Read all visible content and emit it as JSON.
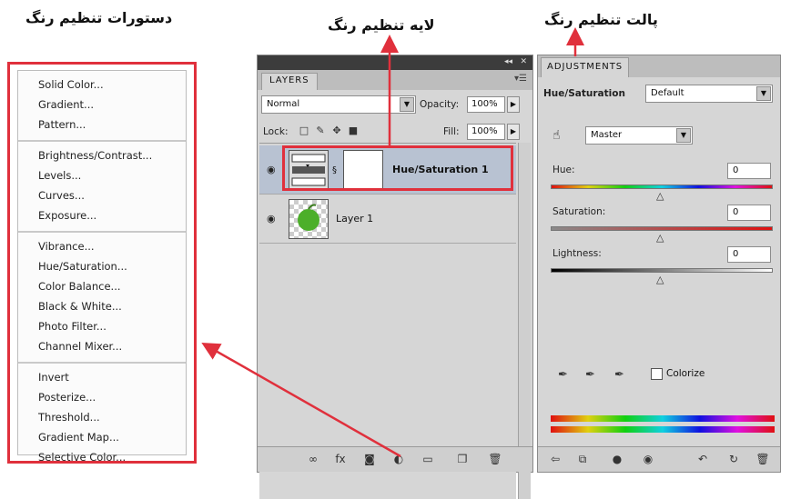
{
  "captions": {
    "menu": "دستورات تنظیم رنگ",
    "layer": "لایه تنظیم رنگ",
    "palette": "پالت تنظیم رنگ"
  },
  "menu": {
    "groups": [
      [
        "Solid Color...",
        "Gradient...",
        "Pattern..."
      ],
      [
        "Brightness/Contrast...",
        "Levels...",
        "Curves...",
        "Exposure..."
      ],
      [
        "Vibrance...",
        "Hue/Saturation...",
        "Color Balance...",
        "Black & White...",
        "Photo Filter...",
        "Channel Mixer..."
      ],
      [
        "Invert",
        "Posterize...",
        "Threshold...",
        "Gradient Map...",
        "Selective Color..."
      ]
    ]
  },
  "layers_panel": {
    "tab": "LAYERS",
    "blend_mode": "Normal",
    "opacity_label": "Opacity:",
    "opacity_value": "100%",
    "lock_label": "Lock:",
    "fill_label": "Fill:",
    "fill_value": "100%",
    "layers": [
      {
        "name": "Hue/Saturation 1",
        "type": "adjustment",
        "selected": true
      },
      {
        "name": "Layer 1",
        "type": "image",
        "selected": false
      }
    ],
    "bottom_icons": [
      "link-icon",
      "fx-icon",
      "mask-icon",
      "adjustment-icon",
      "group-icon",
      "new-layer-icon",
      "trash-icon"
    ]
  },
  "adjustments_panel": {
    "tab": "ADJUSTMENTS",
    "title": "Hue/Saturation",
    "preset": "Default",
    "channel": "Master",
    "hue_label": "Hue:",
    "hue_value": "0",
    "saturation_label": "Saturation:",
    "saturation_value": "0",
    "lightness_label": "Lightness:",
    "lightness_value": "0",
    "colorize_label": "Colorize",
    "colors": {
      "accent": "#e0303c",
      "hue_track": "rainbow",
      "saturation_track": "gray-to-red",
      "lightness_track": "black-to-white"
    }
  }
}
